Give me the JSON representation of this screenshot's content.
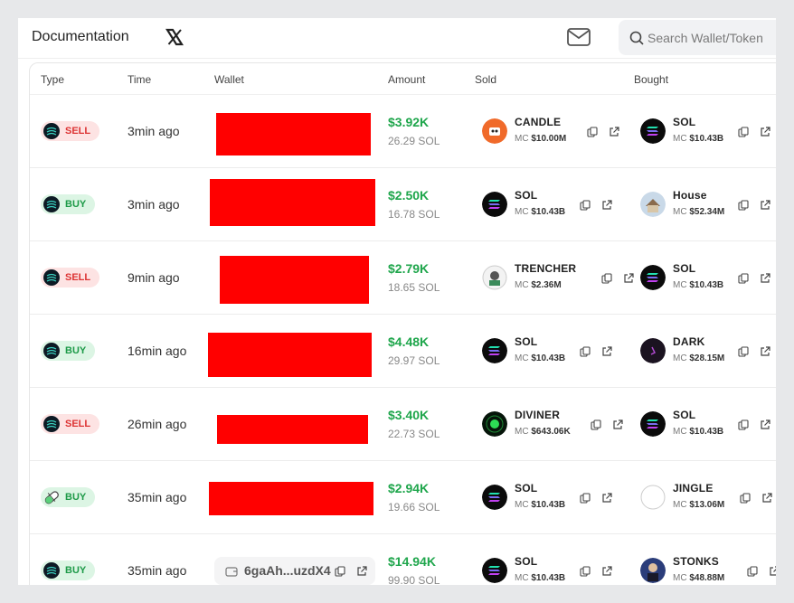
{
  "topbar": {
    "documentation": "Documentation",
    "search_placeholder": "Search Wallet/Token"
  },
  "table": {
    "headers": {
      "type": "Type",
      "time": "Time",
      "wallet": "Wallet",
      "amount": "Amount",
      "sold": "Sold",
      "bought": "Bought"
    }
  },
  "rows": [
    {
      "type": "SELL",
      "time": "3min ago",
      "amount_usd": "$3.92K",
      "amount_sol": "26.29 SOL",
      "sold": {
        "name": "CANDLE",
        "mc_label": "MC",
        "mc": "$10.00M"
      },
      "bought": {
        "name": "SOL",
        "mc_label": "MC",
        "mc": "$10.43B"
      }
    },
    {
      "type": "BUY",
      "time": "3min ago",
      "amount_usd": "$2.50K",
      "amount_sol": "16.78 SOL",
      "sold": {
        "name": "SOL",
        "mc_label": "MC",
        "mc": "$10.43B"
      },
      "bought": {
        "name": "House",
        "mc_label": "MC",
        "mc": "$52.34M"
      }
    },
    {
      "type": "SELL",
      "time": "9min ago",
      "amount_usd": "$2.79K",
      "amount_sol": "18.65 SOL",
      "sold": {
        "name": "TRENCHER",
        "mc_label": "MC",
        "mc": "$2.36M"
      },
      "bought": {
        "name": "SOL",
        "mc_label": "MC",
        "mc": "$10.43B"
      }
    },
    {
      "type": "BUY",
      "time": "16min ago",
      "amount_usd": "$4.48K",
      "amount_sol": "29.97 SOL",
      "sold": {
        "name": "SOL",
        "mc_label": "MC",
        "mc": "$10.43B"
      },
      "bought": {
        "name": "DARK",
        "mc_label": "MC",
        "mc": "$28.15M"
      }
    },
    {
      "type": "SELL",
      "time": "26min ago",
      "amount_usd": "$3.40K",
      "amount_sol": "22.73 SOL",
      "sold": {
        "name": "DIVINER",
        "mc_label": "MC",
        "mc": "$643.06K"
      },
      "bought": {
        "name": "SOL",
        "mc_label": "MC",
        "mc": "$10.43B"
      }
    },
    {
      "type": "BUY",
      "time": "35min ago",
      "amount_usd": "$2.94K",
      "amount_sol": "19.66 SOL",
      "sold": {
        "name": "SOL",
        "mc_label": "MC",
        "mc": "$10.43B"
      },
      "bought": {
        "name": "JINGLE",
        "mc_label": "MC",
        "mc": "$13.06M"
      }
    },
    {
      "type": "BUY",
      "time": "35min ago",
      "wallet": "6gaAh...uzdX4",
      "amount_usd": "$14.94K",
      "amount_sol": "99.90 SOL",
      "sold": {
        "name": "SOL",
        "mc_label": "MC",
        "mc": "$10.43B"
      },
      "bought": {
        "name": "STONKS",
        "mc_label": "MC",
        "mc": "$48.88M"
      }
    }
  ],
  "colors": {
    "green": "#1fa64c",
    "red": "#d33333",
    "redaction": "#ff0000"
  }
}
